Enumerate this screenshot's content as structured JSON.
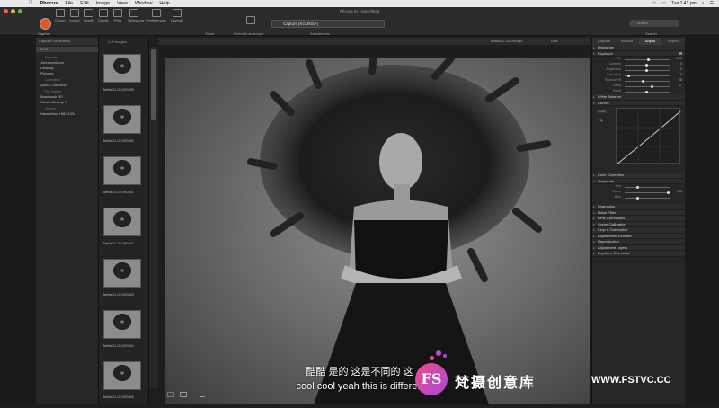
{
  "menubar": {
    "app_name": "Phocus",
    "items": [
      "File",
      "Edit",
      "Image",
      "View",
      "Window",
      "Help"
    ],
    "time": "Tue 1:41 pm"
  },
  "window": {
    "title": "Phocus by Hasselblad"
  },
  "toolbar": {
    "capture_label": "Capture",
    "buttons": [
      "Export",
      "Import",
      "Modify",
      "Delete",
      "Print",
      "Slideshow",
      "Preferences",
      "Layouts"
    ],
    "show_label": "Show",
    "portrait_label": "Portrait/Landscape",
    "session_name": "Capture [KOUKE]+]",
    "adjustments_label": "Adjustments",
    "search_placeholder": "Search",
    "search_label": "Search"
  },
  "left_panel": {
    "header": "Capture Destination",
    "path": "NYC",
    "sections": [
      {
        "title": "Favorites",
        "items": [
          "Johnmonticom",
          "Desktop",
          "Pictures"
        ]
      },
      {
        "title": "Collections",
        "items": [
          "Quick Collection"
        ]
      },
      {
        "title": "File System",
        "items": [
          "Macintosh HD",
          "Studio Backup 7"
        ]
      },
      {
        "title": "Devices",
        "items": [
          "Hasselblad H6D-100c"
        ]
      }
    ]
  },
  "browser": {
    "image_count": "244 Images",
    "thumbnails": [
      "Meika21-02-090339",
      "Meika21-02-090340",
      "Meika21-02-090341",
      "Meika21-02-090342",
      "Meika21-02-090343",
      "Meika21-02-090344",
      "Meika21-02-090345"
    ]
  },
  "viewer": {
    "filename": "Meika21-02-090345",
    "zoom": "15%"
  },
  "right_panel": {
    "tabs": [
      "Capture",
      "Browse",
      "Adjust",
      "Export"
    ],
    "active_tab": "Adjust",
    "tools_top": [
      "Histogram",
      "Exposure"
    ],
    "exposure_sliders": [
      {
        "label": "EV",
        "value": "0.00",
        "pos": 0.55
      },
      {
        "label": "Contrast",
        "value": "0",
        "pos": 0.5
      },
      {
        "label": "Brightness",
        "value": "0",
        "pos": 0.5
      },
      {
        "label": "Saturation",
        "value": "0",
        "pos": 0.08
      },
      {
        "label": "Shadow Fill",
        "value": "28",
        "pos": 0.42
      },
      {
        "label": "Clarity",
        "value": "27",
        "pos": 0.62
      },
      {
        "label": "Detail",
        "value": "",
        "pos": 0.5
      }
    ],
    "tools_mid": [
      "White Balance",
      "Curves"
    ],
    "curve_channel": "RGB",
    "tools_after_curves": [
      "Color Correction",
      "Grayscale"
    ],
    "grayscale_sliders": [
      {
        "label": "Red",
        "value": "",
        "pos": 0.3
      },
      {
        "label": "Green",
        "value": "100",
        "pos": 1.0
      },
      {
        "label": "Blue",
        "value": "",
        "pos": 0.3
      }
    ],
    "tools_bottom": [
      "Sharpness",
      "Noise Filter",
      "Lens Corrections",
      "Scene Calibration",
      "Crop & Orientation",
      "Adjustments Browser",
      "Reproduction",
      "Adjustment Layers",
      "Keystone Correction"
    ]
  },
  "subtitles": {
    "line_cn": "酷酷 是的 这是不同的 这",
    "line_en": "cool cool yeah this is differen"
  },
  "watermark": {
    "logo": "FS",
    "name_cn": "梵摄创意库",
    "url": "WWW.FSTVC.CC"
  },
  "colors": {
    "capture_red": "#e0562a",
    "accent_pink": "#f04a8a",
    "accent_purple": "#a54bd8"
  }
}
